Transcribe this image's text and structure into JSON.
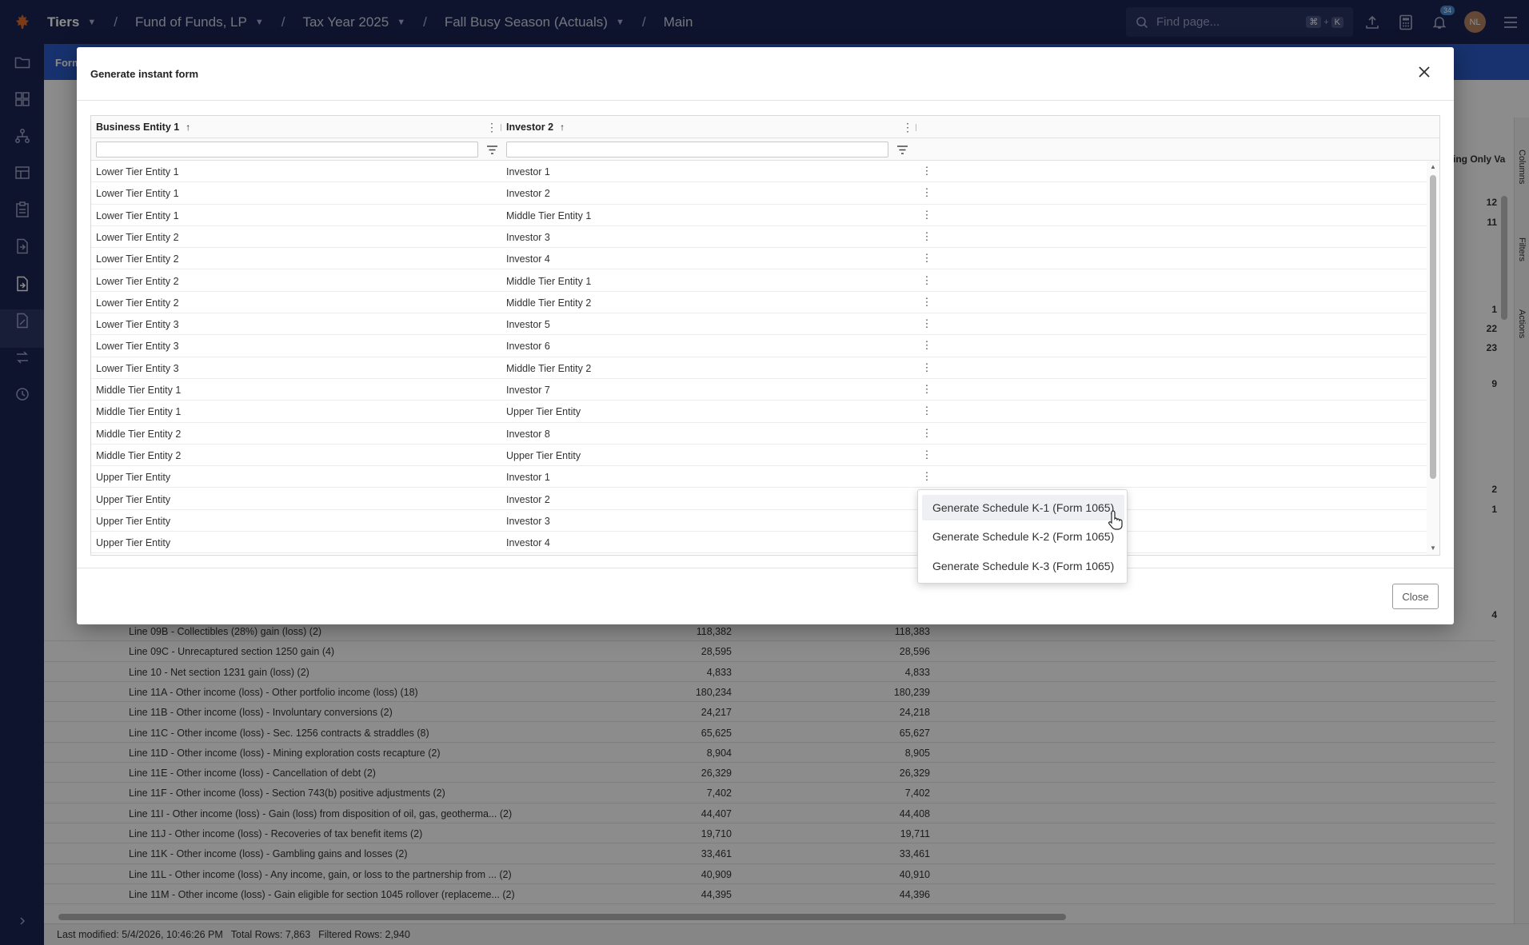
{
  "topbar": {
    "breadcrumbs": [
      "Tiers",
      "Fund of Funds, LP",
      "Tax Year 2025",
      "Fall Busy Season (Actuals)",
      "Main"
    ],
    "search_placeholder": "Find page...",
    "shortcut_key1": "⌘",
    "shortcut_plus": "+",
    "shortcut_key2": "K",
    "notification_count": "34",
    "avatar_initials": "NL"
  },
  "background": {
    "tab_label": "Form",
    "right_header": "ting Only Va",
    "right_numbers": [
      "12",
      "11",
      "1",
      "22",
      "23",
      "9",
      "2",
      "1",
      "4"
    ],
    "side_tabs": [
      "Columns",
      "Filters",
      "Actions"
    ],
    "rows": [
      {
        "label": "Line 09B - Collectibles (28%) gain (loss) (2)",
        "v1": "118,382",
        "v2": "118,383"
      },
      {
        "label": "Line 09C - Unrecaptured section 1250 gain (4)",
        "v1": "28,595",
        "v2": "28,596"
      },
      {
        "label": "Line 10 - Net section 1231 gain (loss) (2)",
        "v1": "4,833",
        "v2": "4,833"
      },
      {
        "label": "Line 11A - Other income (loss) - Other portfolio income (loss) (18)",
        "v1": "180,234",
        "v2": "180,239"
      },
      {
        "label": "Line 11B - Other income (loss) - Involuntary conversions (2)",
        "v1": "24,217",
        "v2": "24,218"
      },
      {
        "label": "Line 11C - Other income (loss) - Sec. 1256 contracts & straddles (8)",
        "v1": "65,625",
        "v2": "65,627"
      },
      {
        "label": "Line 11D - Other income (loss) - Mining exploration costs recapture (2)",
        "v1": "8,904",
        "v2": "8,905"
      },
      {
        "label": "Line 11E - Other income (loss) - Cancellation of debt (2)",
        "v1": "26,329",
        "v2": "26,329"
      },
      {
        "label": "Line 11F - Other income (loss) - Section 743(b) positive adjustments (2)",
        "v1": "7,402",
        "v2": "7,402"
      },
      {
        "label": "Line 11I - Other income (loss) - Gain (loss) from disposition of oil, gas, geotherma...  (2)",
        "v1": "44,407",
        "v2": "44,408"
      },
      {
        "label": "Line 11J - Other income (loss) - Recoveries of tax benefit items (2)",
        "v1": "19,710",
        "v2": "19,711"
      },
      {
        "label": "Line 11K - Other income (loss) - Gambling gains and losses (2)",
        "v1": "33,461",
        "v2": "33,461"
      },
      {
        "label": "Line 11L - Other income (loss) - Any income, gain, or loss to the partnership from ...  (2)",
        "v1": "40,909",
        "v2": "40,910"
      },
      {
        "label": "Line 11M - Other income (loss) - Gain eligible for section 1045 rollover (replaceme...  (2)",
        "v1": "44,395",
        "v2": "44,396"
      }
    ],
    "footer": {
      "last_modified": "Last modified: 5/4/2026, 10:46:26 PM",
      "total_rows": "Total Rows: 7,863",
      "filtered_rows": "Filtered Rows: 2,940"
    }
  },
  "modal": {
    "title": "Generate instant form",
    "close_label": "Close",
    "columns": [
      {
        "label": "Business Entity 1",
        "sort": "↑"
      },
      {
        "label": "Investor 2",
        "sort": "↑"
      }
    ],
    "rows": [
      {
        "entity": "Lower Tier Entity 1",
        "investor": "Investor 1"
      },
      {
        "entity": "Lower Tier Entity 1",
        "investor": "Investor 2"
      },
      {
        "entity": "Lower Tier Entity 1",
        "investor": "Middle Tier Entity 1"
      },
      {
        "entity": "Lower Tier Entity 2",
        "investor": "Investor 3"
      },
      {
        "entity": "Lower Tier Entity 2",
        "investor": "Investor 4"
      },
      {
        "entity": "Lower Tier Entity 2",
        "investor": "Middle Tier Entity 1"
      },
      {
        "entity": "Lower Tier Entity 2",
        "investor": "Middle Tier Entity 2"
      },
      {
        "entity": "Lower Tier Entity 3",
        "investor": "Investor 5"
      },
      {
        "entity": "Lower Tier Entity 3",
        "investor": "Investor 6"
      },
      {
        "entity": "Lower Tier Entity 3",
        "investor": "Middle Tier Entity 2"
      },
      {
        "entity": "Middle Tier Entity 1",
        "investor": "Investor 7"
      },
      {
        "entity": "Middle Tier Entity 1",
        "investor": "Upper Tier Entity"
      },
      {
        "entity": "Middle Tier Entity 2",
        "investor": "Investor 8"
      },
      {
        "entity": "Middle Tier Entity 2",
        "investor": "Upper Tier Entity"
      },
      {
        "entity": "Upper Tier Entity",
        "investor": "Investor 1"
      },
      {
        "entity": "Upper Tier Entity",
        "investor": "Investor 2"
      },
      {
        "entity": "Upper Tier Entity",
        "investor": "Investor 3"
      },
      {
        "entity": "Upper Tier Entity",
        "investor": "Investor 4"
      }
    ],
    "dropdown": {
      "items": [
        "Generate Schedule K-1 (Form 1065)",
        "Generate Schedule K-2 (Form 1065)",
        "Generate Schedule K-3 (Form 1065)"
      ],
      "hovered_index": 0
    }
  },
  "colors": {
    "nav_bg": "#1c2554",
    "tab_bar": "#2b5bc9",
    "badge": "#4a8fd6",
    "avatar": "#b88262"
  }
}
